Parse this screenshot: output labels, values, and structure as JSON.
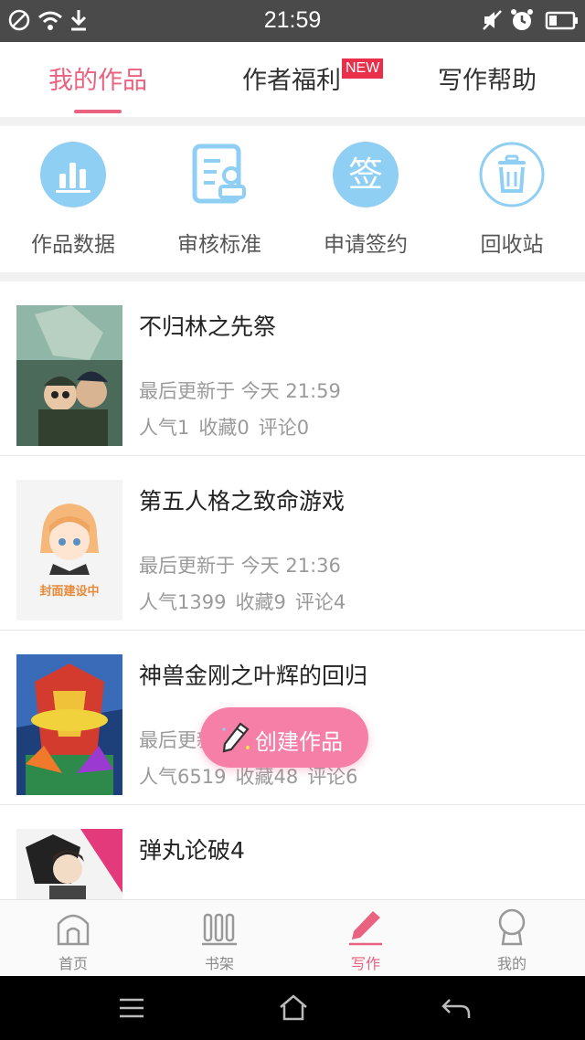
{
  "status": {
    "time": "21:59"
  },
  "tabs": {
    "items": [
      {
        "label": "我的作品",
        "active": true
      },
      {
        "label": "作者福利",
        "badge": "NEW"
      },
      {
        "label": "写作帮助"
      }
    ]
  },
  "actions": [
    {
      "label": "作品数据",
      "icon": "bar-chart-icon"
    },
    {
      "label": "审核标准",
      "icon": "review-standard-icon"
    },
    {
      "label": "申请签约",
      "icon": "sign-contract-icon",
      "glyph": "签"
    },
    {
      "label": "回收站",
      "icon": "trash-icon"
    }
  ],
  "works": [
    {
      "title": "不归林之先祭",
      "updated": "最后更新于 今天 21:59",
      "popularity": "人气1",
      "favorites": "收藏0",
      "comments": "评论0"
    },
    {
      "title": "第五人格之致命游戏",
      "updated": "最后更新于 今天 21:36",
      "popularity": "人气1399",
      "favorites": "收藏9",
      "comments": "评论4",
      "cover_text": "封面建设中"
    },
    {
      "title": "神兽金刚之叶辉的回归",
      "updated": "最后更新于",
      "popularity": "人气6519",
      "favorites": "收藏48",
      "comments": "评论6"
    },
    {
      "title": "弹丸论破4"
    }
  ],
  "fab": {
    "label": "创建作品"
  },
  "bottom_nav": [
    {
      "label": "首页"
    },
    {
      "label": "书架"
    },
    {
      "label": "写作",
      "active": true
    },
    {
      "label": "我的"
    }
  ],
  "colors": {
    "accent": "#e9627f",
    "icon_blue": "#8fcff3",
    "fab": "#f57fa6"
  }
}
